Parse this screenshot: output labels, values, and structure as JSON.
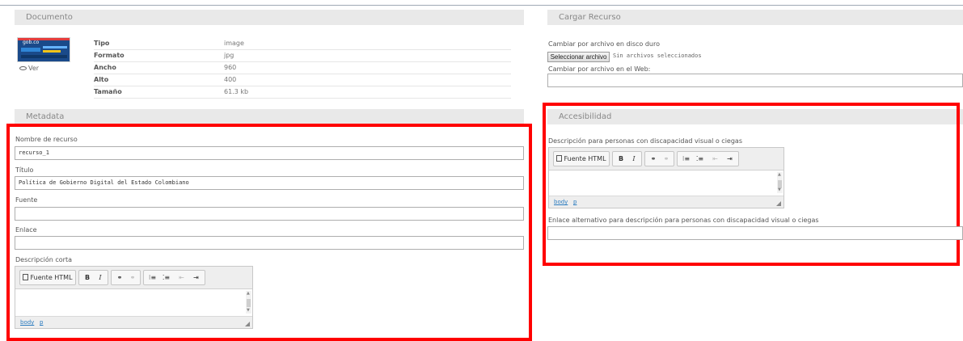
{
  "documento": {
    "header": "Documento",
    "ver_label": "Ver",
    "rows": [
      {
        "key": "Tipo",
        "value": "image"
      },
      {
        "key": "Formato",
        "value": "jpg"
      },
      {
        "key": "Ancho",
        "value": "960"
      },
      {
        "key": "Alto",
        "value": "400"
      },
      {
        "key": "Tamaño",
        "value": "61.3 kb"
      }
    ]
  },
  "metadata": {
    "header": "Metadata",
    "nombre_label": "Nombre de recurso",
    "nombre_value": "recurso_1",
    "titulo_label": "Título",
    "titulo_value": "Política de Gobierno Digital del Estado Colombiano",
    "fuente_label": "Fuente",
    "fuente_value": "",
    "enlace_label": "Enlace",
    "enlace_value": "",
    "descripcion_label": "Descripción corta"
  },
  "editor": {
    "source_label": "Fuente HTML",
    "bold": "B",
    "italic": "I",
    "path_body": "body",
    "path_p": "p"
  },
  "cargar": {
    "header": "Cargar Recurso",
    "disco_label": "Cambiar por archivo en disco duro",
    "file_button": "Seleccionar archivo",
    "file_status": "Sin archivos seleccionados",
    "web_label": "Cambiar por archivo en el Web:"
  },
  "accesibilidad": {
    "header": "Accesibilidad",
    "descripcion_label": "Descripción para personas con discapacidad visual o ciegas",
    "enlace_label": "Enlace alternativo para descripción para personas con discapacidad visual o ciegas"
  },
  "colors": {
    "highlight": "#ff0000",
    "link": "#2a7bbf",
    "header_bg": "#e9e9e9"
  }
}
